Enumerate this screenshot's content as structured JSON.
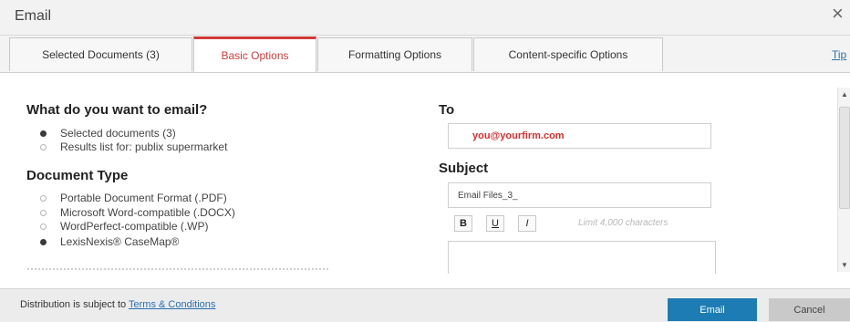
{
  "dialog": {
    "title": "Email",
    "close_symbol": "×"
  },
  "tabs": [
    {
      "label": "Selected Documents (3)",
      "active": false
    },
    {
      "label": "Basic Options",
      "active": true
    },
    {
      "label": "Formatting Options",
      "active": false
    },
    {
      "label": "Content-specific Options",
      "active": false
    }
  ],
  "tips_link": "Tip",
  "what_to_email": {
    "heading": "What do you want to email?",
    "options": [
      {
        "label": "Selected documents (3)",
        "selected": true
      },
      {
        "label": "Results list for: publix supermarket",
        "selected": false
      }
    ]
  },
  "document_type": {
    "heading": "Document Type",
    "options": [
      {
        "label": "Portable Document Format (.PDF)",
        "selected": false
      },
      {
        "label": "Microsoft Word-compatible (.DOCX)",
        "selected": false
      },
      {
        "label": "WordPerfect-compatible (.WP)",
        "selected": false
      },
      {
        "label": "LexisNexis® CaseMap®",
        "selected": true
      }
    ]
  },
  "to_field": {
    "label": "To",
    "value": "you@yourfirm.com"
  },
  "subject_field": {
    "label": "Subject",
    "value": "Email Files_3_"
  },
  "formatting": {
    "bold": "B",
    "underline": "U",
    "italic": "I",
    "limit_text": "Limit 4,000 characters"
  },
  "footer": {
    "text": "Distribution is subject to",
    "link": "Terms & Conditions",
    "email_button": "Email",
    "cancel_button": "Cancel"
  },
  "colors": {
    "accent_red": "#d23a3a",
    "primary_blue": "#1d7cb3",
    "link_blue": "#2a6fb4"
  }
}
